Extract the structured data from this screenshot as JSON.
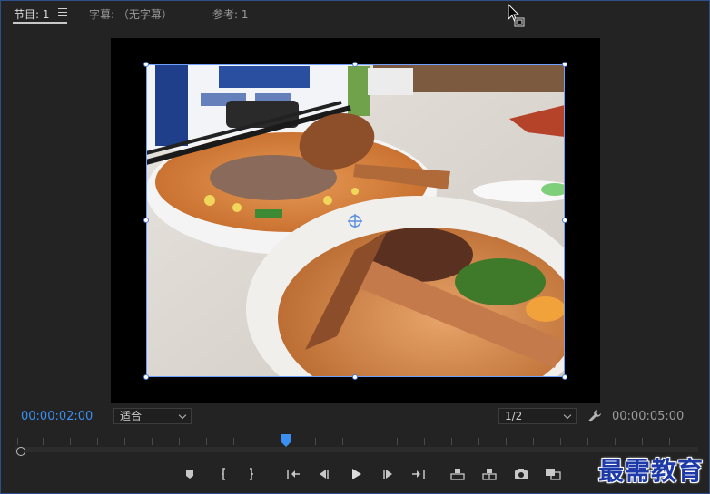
{
  "tabs": [
    {
      "label": "节目: 1"
    },
    {
      "label": "字幕: （无字幕）"
    },
    {
      "label": "参考: 1"
    }
  ],
  "monitor": {
    "current_timecode": "00:00:02:00",
    "duration_timecode": "00:00:05:00",
    "zoom": "适合",
    "resolution": "1/2"
  },
  "transport": {
    "buttons": [
      "marker",
      "mark-in",
      "mark-out",
      "go-to-in",
      "step-back",
      "play",
      "step-forward",
      "go-to-out",
      "lift",
      "extract",
      "export-frame",
      "compare"
    ]
  },
  "watermark": "最需教育",
  "colors": {
    "accent": "#3a8ff0",
    "background": "#232323",
    "selection": "#6fa0ff"
  }
}
